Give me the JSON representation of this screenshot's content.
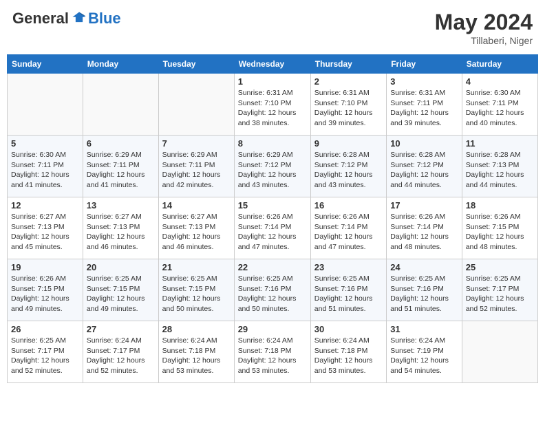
{
  "header": {
    "logo_general": "General",
    "logo_blue": "Blue",
    "month_year": "May 2024",
    "location": "Tillaberi, Niger"
  },
  "days_of_week": [
    "Sunday",
    "Monday",
    "Tuesday",
    "Wednesday",
    "Thursday",
    "Friday",
    "Saturday"
  ],
  "weeks": [
    [
      {
        "day": "",
        "info": ""
      },
      {
        "day": "",
        "info": ""
      },
      {
        "day": "",
        "info": ""
      },
      {
        "day": "1",
        "info": "Sunrise: 6:31 AM\nSunset: 7:10 PM\nDaylight: 12 hours\nand 38 minutes."
      },
      {
        "day": "2",
        "info": "Sunrise: 6:31 AM\nSunset: 7:10 PM\nDaylight: 12 hours\nand 39 minutes."
      },
      {
        "day": "3",
        "info": "Sunrise: 6:31 AM\nSunset: 7:11 PM\nDaylight: 12 hours\nand 39 minutes."
      },
      {
        "day": "4",
        "info": "Sunrise: 6:30 AM\nSunset: 7:11 PM\nDaylight: 12 hours\nand 40 minutes."
      }
    ],
    [
      {
        "day": "5",
        "info": "Sunrise: 6:30 AM\nSunset: 7:11 PM\nDaylight: 12 hours\nand 41 minutes."
      },
      {
        "day": "6",
        "info": "Sunrise: 6:29 AM\nSunset: 7:11 PM\nDaylight: 12 hours\nand 41 minutes."
      },
      {
        "day": "7",
        "info": "Sunrise: 6:29 AM\nSunset: 7:11 PM\nDaylight: 12 hours\nand 42 minutes."
      },
      {
        "day": "8",
        "info": "Sunrise: 6:29 AM\nSunset: 7:12 PM\nDaylight: 12 hours\nand 43 minutes."
      },
      {
        "day": "9",
        "info": "Sunrise: 6:28 AM\nSunset: 7:12 PM\nDaylight: 12 hours\nand 43 minutes."
      },
      {
        "day": "10",
        "info": "Sunrise: 6:28 AM\nSunset: 7:12 PM\nDaylight: 12 hours\nand 44 minutes."
      },
      {
        "day": "11",
        "info": "Sunrise: 6:28 AM\nSunset: 7:13 PM\nDaylight: 12 hours\nand 44 minutes."
      }
    ],
    [
      {
        "day": "12",
        "info": "Sunrise: 6:27 AM\nSunset: 7:13 PM\nDaylight: 12 hours\nand 45 minutes."
      },
      {
        "day": "13",
        "info": "Sunrise: 6:27 AM\nSunset: 7:13 PM\nDaylight: 12 hours\nand 46 minutes."
      },
      {
        "day": "14",
        "info": "Sunrise: 6:27 AM\nSunset: 7:13 PM\nDaylight: 12 hours\nand 46 minutes."
      },
      {
        "day": "15",
        "info": "Sunrise: 6:26 AM\nSunset: 7:14 PM\nDaylight: 12 hours\nand 47 minutes."
      },
      {
        "day": "16",
        "info": "Sunrise: 6:26 AM\nSunset: 7:14 PM\nDaylight: 12 hours\nand 47 minutes."
      },
      {
        "day": "17",
        "info": "Sunrise: 6:26 AM\nSunset: 7:14 PM\nDaylight: 12 hours\nand 48 minutes."
      },
      {
        "day": "18",
        "info": "Sunrise: 6:26 AM\nSunset: 7:15 PM\nDaylight: 12 hours\nand 48 minutes."
      }
    ],
    [
      {
        "day": "19",
        "info": "Sunrise: 6:26 AM\nSunset: 7:15 PM\nDaylight: 12 hours\nand 49 minutes."
      },
      {
        "day": "20",
        "info": "Sunrise: 6:25 AM\nSunset: 7:15 PM\nDaylight: 12 hours\nand 49 minutes."
      },
      {
        "day": "21",
        "info": "Sunrise: 6:25 AM\nSunset: 7:15 PM\nDaylight: 12 hours\nand 50 minutes."
      },
      {
        "day": "22",
        "info": "Sunrise: 6:25 AM\nSunset: 7:16 PM\nDaylight: 12 hours\nand 50 minutes."
      },
      {
        "day": "23",
        "info": "Sunrise: 6:25 AM\nSunset: 7:16 PM\nDaylight: 12 hours\nand 51 minutes."
      },
      {
        "day": "24",
        "info": "Sunrise: 6:25 AM\nSunset: 7:16 PM\nDaylight: 12 hours\nand 51 minutes."
      },
      {
        "day": "25",
        "info": "Sunrise: 6:25 AM\nSunset: 7:17 PM\nDaylight: 12 hours\nand 52 minutes."
      }
    ],
    [
      {
        "day": "26",
        "info": "Sunrise: 6:25 AM\nSunset: 7:17 PM\nDaylight: 12 hours\nand 52 minutes."
      },
      {
        "day": "27",
        "info": "Sunrise: 6:24 AM\nSunset: 7:17 PM\nDaylight: 12 hours\nand 52 minutes."
      },
      {
        "day": "28",
        "info": "Sunrise: 6:24 AM\nSunset: 7:18 PM\nDaylight: 12 hours\nand 53 minutes."
      },
      {
        "day": "29",
        "info": "Sunrise: 6:24 AM\nSunset: 7:18 PM\nDaylight: 12 hours\nand 53 minutes."
      },
      {
        "day": "30",
        "info": "Sunrise: 6:24 AM\nSunset: 7:18 PM\nDaylight: 12 hours\nand 53 minutes."
      },
      {
        "day": "31",
        "info": "Sunrise: 6:24 AM\nSunset: 7:19 PM\nDaylight: 12 hours\nand 54 minutes."
      },
      {
        "day": "",
        "info": ""
      }
    ]
  ]
}
